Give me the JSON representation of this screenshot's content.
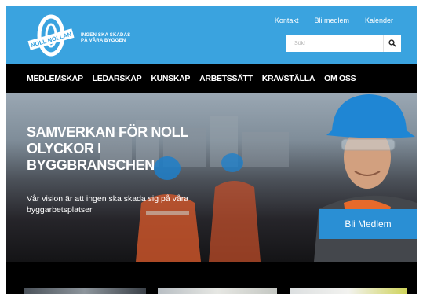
{
  "brand": {
    "logo_text": "NOLL NOLLAN",
    "tagline_line1": "INGEN SKA SKADAS",
    "tagline_line2": "PÅ VÅRA BYGGEN"
  },
  "toplinks": [
    "Kontakt",
    "Bli medlem",
    "Kalender"
  ],
  "search": {
    "placeholder": "Sök!"
  },
  "nav": [
    "MEDLEMSKAP",
    "LEDARSKAP",
    "KUNSKAP",
    "ARBETSSÄTT",
    "KRAVSTÄLLA",
    "OM OSS"
  ],
  "hero": {
    "title": "SAMVERKAN FÖR NOLL OLYCKOR I BYGGBRANSCHEN",
    "subtitle": "Vår vision är att ingen ska skada sig på våra byggarbetsplatser",
    "cta": "Bli Medlem"
  },
  "colors": {
    "header": "#3aa3df",
    "nav": "#000000",
    "cta": "#2a8fd4"
  }
}
